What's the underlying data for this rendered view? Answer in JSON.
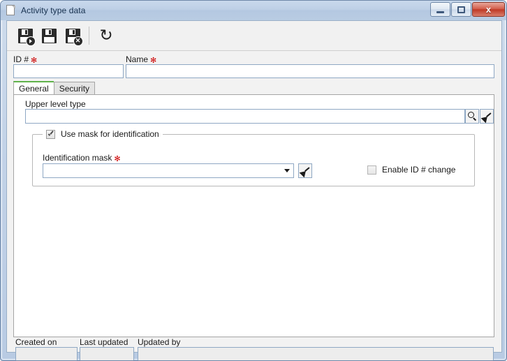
{
  "window": {
    "title": "Activity type data",
    "title_icon": "document-page-icon",
    "buttons": {
      "minimize": "–",
      "restore": "□",
      "close": "x"
    }
  },
  "toolbar": {
    "items": [
      {
        "name": "save-and-new-button",
        "icon": "floppy-disk-with-arrow-icon"
      },
      {
        "name": "save-button",
        "icon": "floppy-disk-icon"
      },
      {
        "name": "save-and-close-button",
        "icon": "floppy-disk-with-x-icon"
      },
      {
        "name": "refresh-button",
        "icon": "refresh-icon",
        "glyph": "↻"
      }
    ]
  },
  "header_fields": {
    "id": {
      "label": "ID #",
      "required_marker": "✻",
      "value": "",
      "placeholder": ""
    },
    "name": {
      "label": "Name",
      "required_marker": "✻",
      "value": "",
      "placeholder": ""
    }
  },
  "tabs": [
    {
      "label": "General",
      "active": true
    },
    {
      "label": "Security",
      "active": false
    }
  ],
  "general_tab": {
    "upper_level_type": {
      "label": "Upper level type",
      "value": "",
      "placeholder": "",
      "search_icon": "magnifier-icon",
      "clear_icon": "broom-icon"
    },
    "mask_group": {
      "checkbox_label": "Use mask for identification",
      "checkbox_checked": true,
      "identification_mask": {
        "label": "Identification mask",
        "required_marker": "✻",
        "selected_value": "",
        "options": [],
        "clear_icon": "broom-icon",
        "caret_icon": "chevron-down-icon"
      },
      "enable_id_change": {
        "label": "Enable ID # change",
        "checked": false
      }
    }
  },
  "footer": {
    "created_on": {
      "label": "Created on",
      "value": ""
    },
    "last_updated": {
      "label": "Last updated",
      "value": ""
    },
    "updated_by": {
      "label": "Updated by",
      "value": ""
    }
  },
  "colors": {
    "titlebar": "#b9cce3",
    "accent_tab": "#5fb24a",
    "required": "#cc0000",
    "close_button": "#bf3a26",
    "field_border": "#8fa8c4"
  }
}
